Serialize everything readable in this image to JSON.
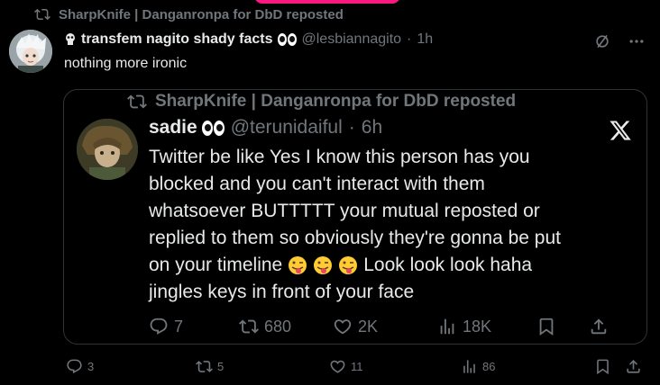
{
  "outer_repost": {
    "label": "SharpKnife | Danganronpa for DbD reposted"
  },
  "post": {
    "display_name": "transfem nagito shady facts",
    "handle": "@lesbiannagito",
    "separator": "·",
    "time": "1h",
    "text": "nothing more ironic",
    "stats": {
      "replies": "3",
      "reposts": "5",
      "likes": "11",
      "views": "86"
    }
  },
  "quote": {
    "repost_label": "SharpKnife | Danganronpa for DbD reposted",
    "display_name": "sadie",
    "handle": "@terunidaiful",
    "separator": "·",
    "time": "6h",
    "text_lines": [
      "Twitter be like Yes I know this person has you",
      "blocked and you can't interact with them",
      "whatsoever BUTTTTT your mutual reposted or",
      "replied to them so obviously they're gonna be put",
      "on your timeline",
      "Look look look haha",
      "jingles keys in front of your face"
    ],
    "stats": {
      "replies": "7",
      "reposts": "680",
      "likes": "2K",
      "views": "18K"
    }
  },
  "icons": {
    "repost": "repost-icon",
    "reply": "reply-icon",
    "like": "heart-icon",
    "views": "views-icon",
    "bookmark": "bookmark-icon",
    "share": "share-icon",
    "more": "more-icon",
    "grok": "slash-circle-icon",
    "x_logo": "x-logo-icon",
    "tongue": "winking-tongue-emoji",
    "eyes": "eyes-emoji",
    "flag": "skull-flag-emoji"
  },
  "colors": {
    "background": "#000000",
    "text": "#e7e9ea",
    "muted": "#71767b",
    "border": "#2f3336",
    "accent": "#f91880"
  }
}
